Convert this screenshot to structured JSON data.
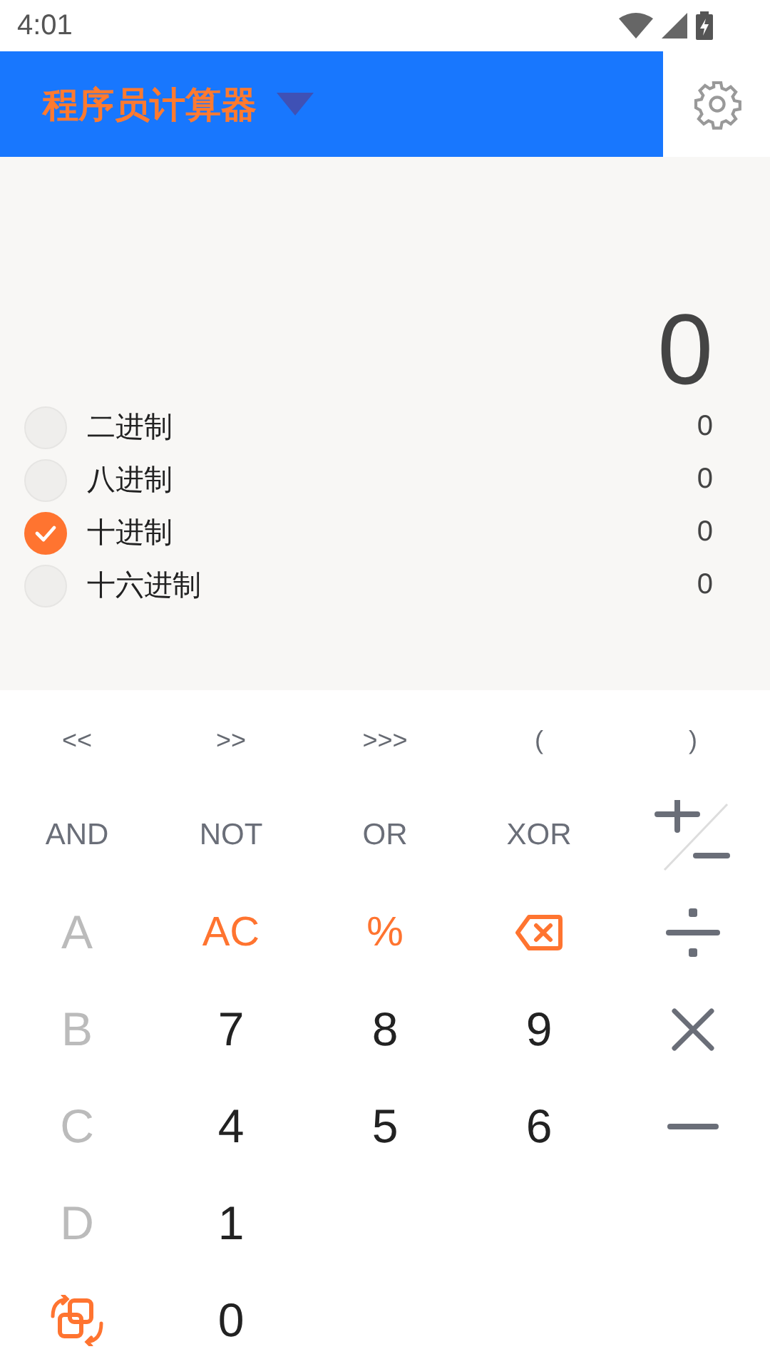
{
  "status_bar": {
    "time": "4:01"
  },
  "header": {
    "title": "程序员计算器"
  },
  "display": {
    "value": "0"
  },
  "bases": [
    {
      "label": "二进制",
      "value": "0",
      "selected": false
    },
    {
      "label": "八进制",
      "value": "0",
      "selected": false
    },
    {
      "label": "十进制",
      "value": "0",
      "selected": true
    },
    {
      "label": "十六进制",
      "value": "0",
      "selected": false
    }
  ],
  "keypad": [
    [
      {
        "kind": "shift",
        "label": "<<"
      },
      {
        "kind": "shift",
        "label": ">>"
      },
      {
        "kind": "shift",
        "label": ">>>"
      },
      {
        "kind": "shift",
        "label": "("
      },
      {
        "kind": "shift",
        "label": ")"
      }
    ],
    [
      {
        "kind": "logic",
        "label": "AND"
      },
      {
        "kind": "logic",
        "label": "NOT"
      },
      {
        "kind": "logic",
        "label": "OR"
      },
      {
        "kind": "logic",
        "label": "XOR"
      },
      {
        "kind": "plusminus"
      }
    ],
    [
      {
        "kind": "digit",
        "label": "A",
        "disabled": true
      },
      {
        "kind": "function",
        "label": "AC"
      },
      {
        "kind": "function",
        "label": "%"
      },
      {
        "kind": "backspace"
      },
      {
        "kind": "divide"
      }
    ],
    [
      {
        "kind": "digit",
        "label": "B",
        "disabled": true
      },
      {
        "kind": "digit",
        "label": "7",
        "disabled": false
      },
      {
        "kind": "digit",
        "label": "8",
        "disabled": false
      },
      {
        "kind": "digit",
        "label": "9",
        "disabled": false
      },
      {
        "kind": "times"
      }
    ],
    [
      {
        "kind": "digit",
        "label": "C",
        "disabled": true
      },
      {
        "kind": "digit",
        "label": "4",
        "disabled": false
      },
      {
        "kind": "digit",
        "label": "5",
        "disabled": false
      },
      {
        "kind": "digit",
        "label": "6",
        "disabled": false
      },
      {
        "kind": "minus"
      }
    ],
    [
      {
        "kind": "digit",
        "label": "D",
        "disabled": true
      },
      {
        "kind": "digit",
        "label": "1",
        "disabled": false
      }
    ],
    [
      {
        "kind": "swap"
      },
      {
        "kind": "digit",
        "label": "0",
        "disabled": false
      }
    ]
  ]
}
